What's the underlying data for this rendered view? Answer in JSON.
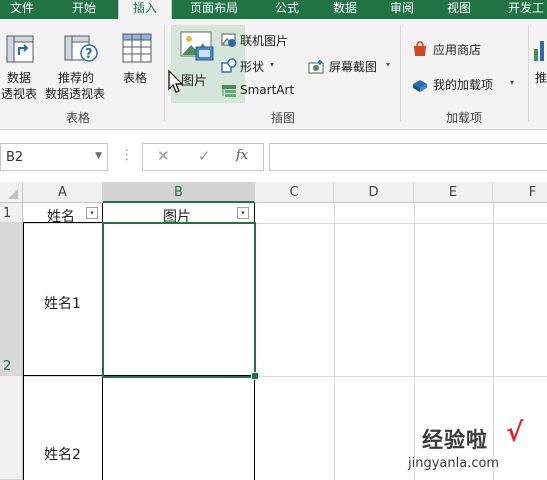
{
  "ribbon_tabs": [
    "文件",
    "开始",
    "插入",
    "页面布局",
    "公式",
    "数据",
    "审阅",
    "视图",
    "开发工"
  ],
  "active_tab": "插入",
  "ribbon": {
    "tables_group": {
      "label": "表格",
      "pivot_table": [
        "数据",
        "透视表"
      ],
      "recommended_pivot": [
        "推荐的",
        "数据透视表"
      ],
      "table": "表格"
    },
    "illustrations_group": {
      "label": "插图",
      "picture": "图片",
      "online_pictures": "联机图片",
      "shapes": "形状",
      "smartart": "SmartArt",
      "screenshot": "屏幕截图"
    },
    "addins_group": {
      "label": "加载项",
      "store": "应用商店",
      "my_addins": "我的加载项"
    },
    "cut_off_label": "推"
  },
  "formula_bar": {
    "name_box": "B2",
    "cancel_icon": "✕",
    "enter_icon": "✓",
    "fx": "fx",
    "formula": ""
  },
  "sheet": {
    "columns": [
      "A",
      "B",
      "C",
      "D",
      "E",
      "F"
    ],
    "selected_column": "B",
    "rows": [
      "1",
      "2"
    ],
    "selected_row": "2",
    "cells": {
      "A1": "姓名",
      "B1": "图片",
      "A2": "姓名1",
      "A3": "姓名2"
    }
  },
  "watermark": {
    "text": "经验啦",
    "check": "√",
    "url": "jingyanla.com"
  },
  "colors": {
    "accent": "#217346",
    "ribbon_bg": "#f3f3f3",
    "hover_bg": "#d4e5d9"
  }
}
